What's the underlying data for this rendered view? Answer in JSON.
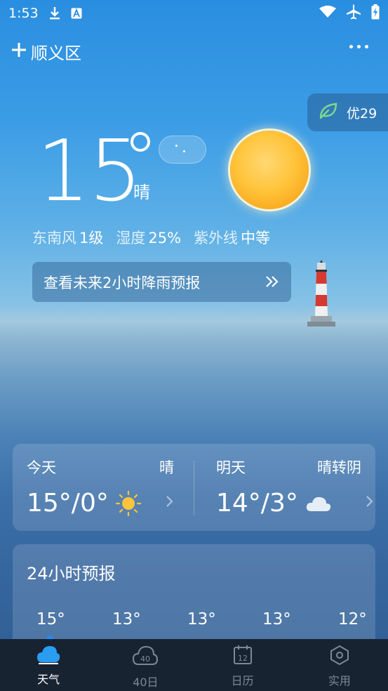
{
  "status_bar": {
    "time": "1:53",
    "icons": [
      "download-icon",
      "a-badge-icon",
      "wifi-icon",
      "airplane-icon",
      "battery-charging-icon"
    ]
  },
  "header": {
    "add_icon": "plus-icon",
    "location": "顺义区",
    "more_icon": "more-dots-icon"
  },
  "aqi": {
    "icon": "leaf-icon",
    "label": "优29"
  },
  "current": {
    "temperature": "15",
    "condition": "晴",
    "wind_label": "东南风",
    "wind_value": "1级",
    "humidity_label": "湿度",
    "humidity_value": "25%",
    "uv_label": "紫外线",
    "uv_value": "中等"
  },
  "rain_banner": {
    "text": "查看未来2小时降雨预报",
    "icon": "double-chevron-right-icon"
  },
  "today": {
    "label": "今天",
    "condition": "晴",
    "range": "15°/0°",
    "icon": "sun-icon"
  },
  "tomorrow": {
    "label": "明天",
    "condition": "晴转阴",
    "range": "14°/3°",
    "icon": "cloud-icon"
  },
  "hourly": {
    "title": "24小时预报",
    "temps": [
      "15°",
      "13°",
      "13°",
      "13°",
      "12°"
    ]
  },
  "nav": {
    "items": [
      {
        "label": "天气",
        "icon": "cloud-icon",
        "active": true
      },
      {
        "label": "40日",
        "icon": "cloud-40-icon",
        "active": false
      },
      {
        "label": "日历",
        "icon": "calendar-icon",
        "active": false
      },
      {
        "label": "实用",
        "icon": "hexagon-icon",
        "active": false
      }
    ]
  },
  "colors": {
    "nav_background": "#182332",
    "active_dot": "#1d8dff",
    "sun": "#ffc43b",
    "aqi_leaf": "#7dd88f"
  }
}
